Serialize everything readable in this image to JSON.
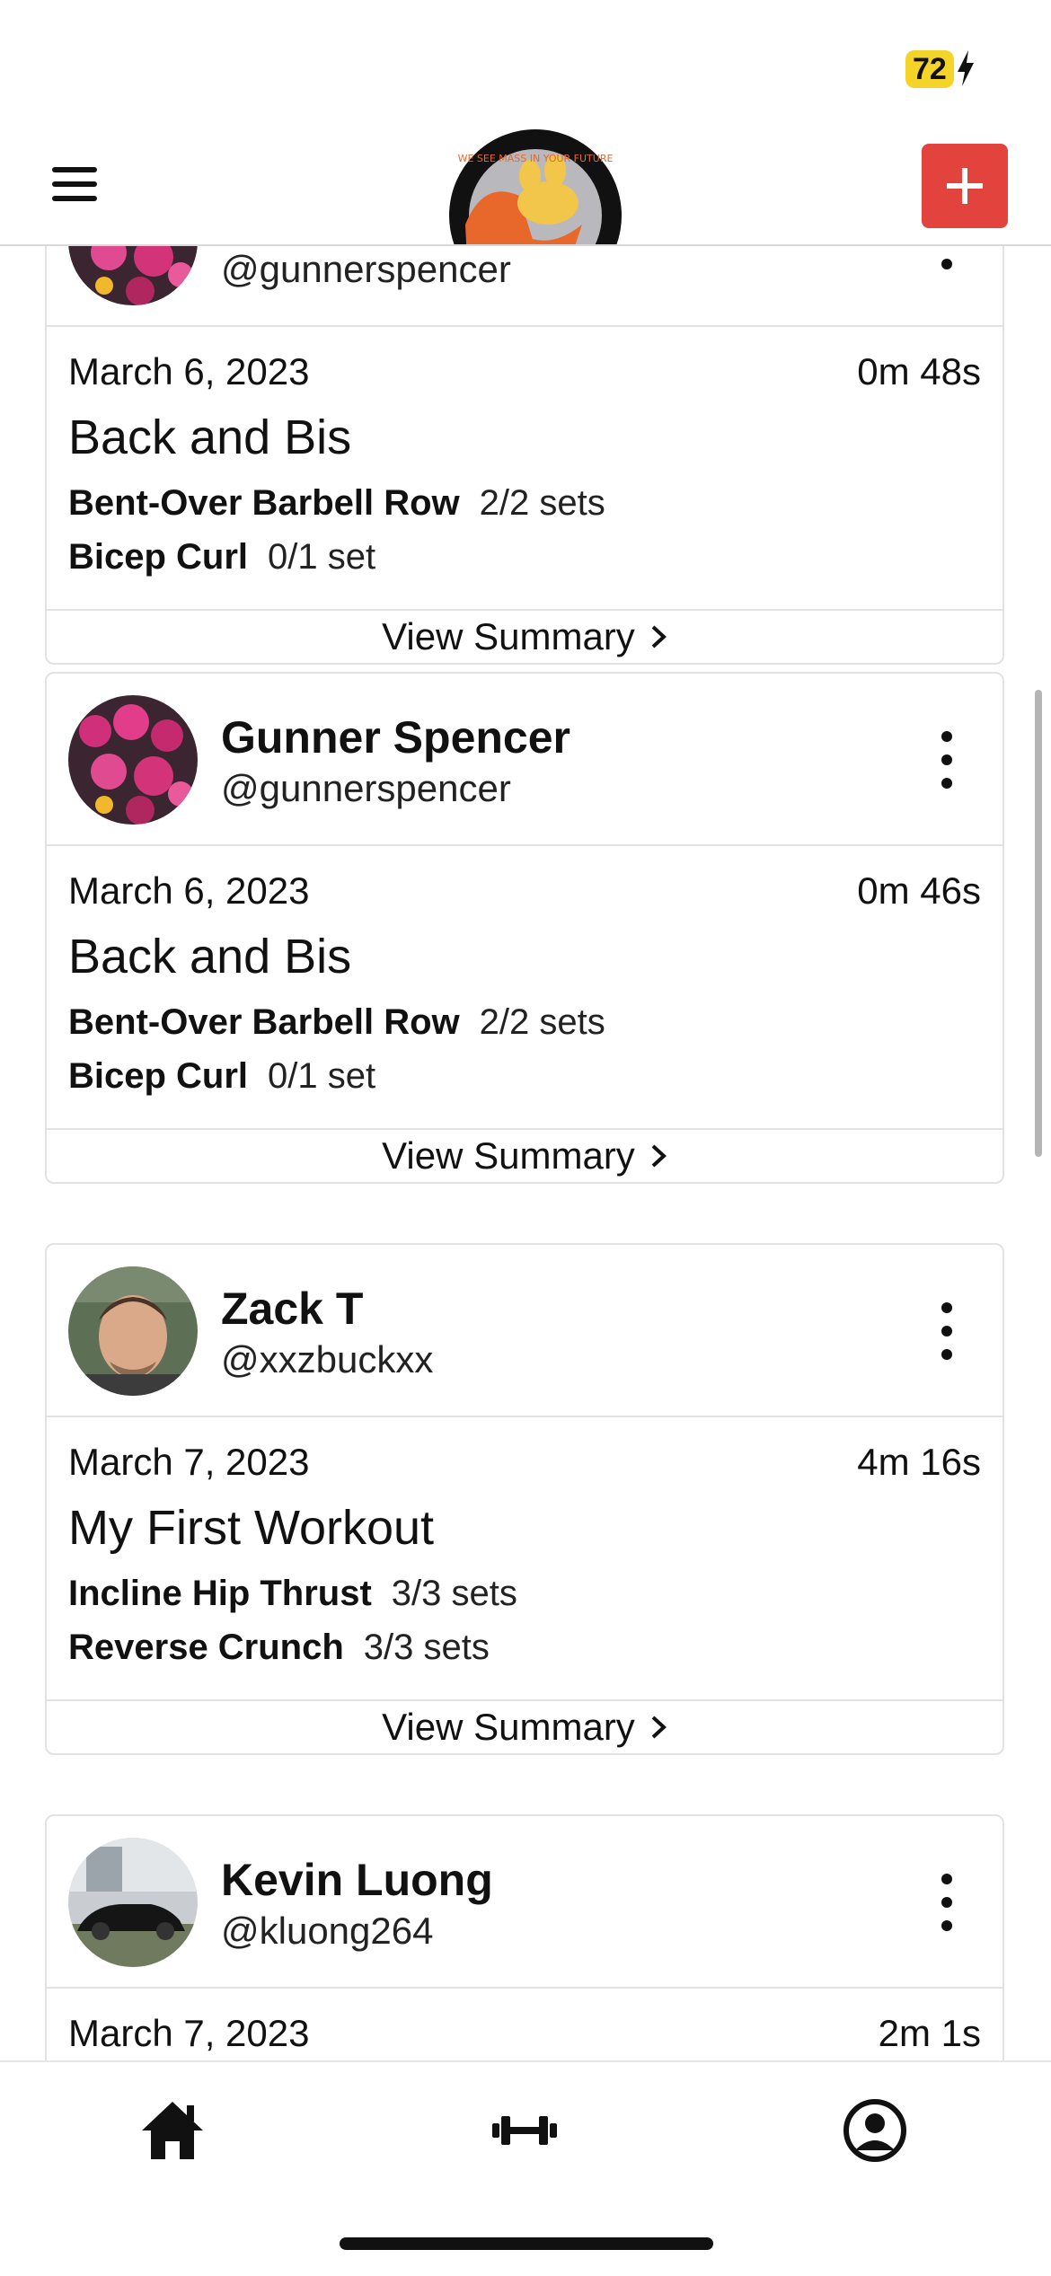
{
  "status": {
    "battery": "72"
  },
  "header": {
    "logo_text": "WE SEE MASS IN YOUR FUTURE"
  },
  "feed": [
    {
      "name": "",
      "handle": "@gunnerspencer",
      "date": "March 6, 2023",
      "duration": "0m 48s",
      "workout": "Back and Bis",
      "exercises": [
        {
          "name": "Bent-Over Barbell Row",
          "sets": "2/2 sets"
        },
        {
          "name": "Bicep Curl",
          "sets": "0/1 set"
        }
      ],
      "summary": "View Summary"
    },
    {
      "name": "Gunner Spencer",
      "handle": "@gunnerspencer",
      "date": "March 6, 2023",
      "duration": "0m 46s",
      "workout": "Back and Bis",
      "exercises": [
        {
          "name": "Bent-Over Barbell Row",
          "sets": "2/2 sets"
        },
        {
          "name": "Bicep Curl",
          "sets": "0/1 set"
        }
      ],
      "summary": "View Summary"
    },
    {
      "name": "Zack T",
      "handle": "@xxzbuckxx",
      "date": "March 7, 2023",
      "duration": "4m 16s",
      "workout": "My First Workout",
      "exercises": [
        {
          "name": "Incline Hip Thrust",
          "sets": "3/3 sets"
        },
        {
          "name": "Reverse Crunch",
          "sets": "3/3 sets"
        }
      ],
      "summary": "View Summary"
    },
    {
      "name": "Kevin Luong",
      "handle": "@kluong264",
      "date": "March 7, 2023",
      "duration": "2m 1s"
    }
  ],
  "tabs": [
    "home-icon",
    "dumbbell-icon",
    "profile-icon"
  ]
}
